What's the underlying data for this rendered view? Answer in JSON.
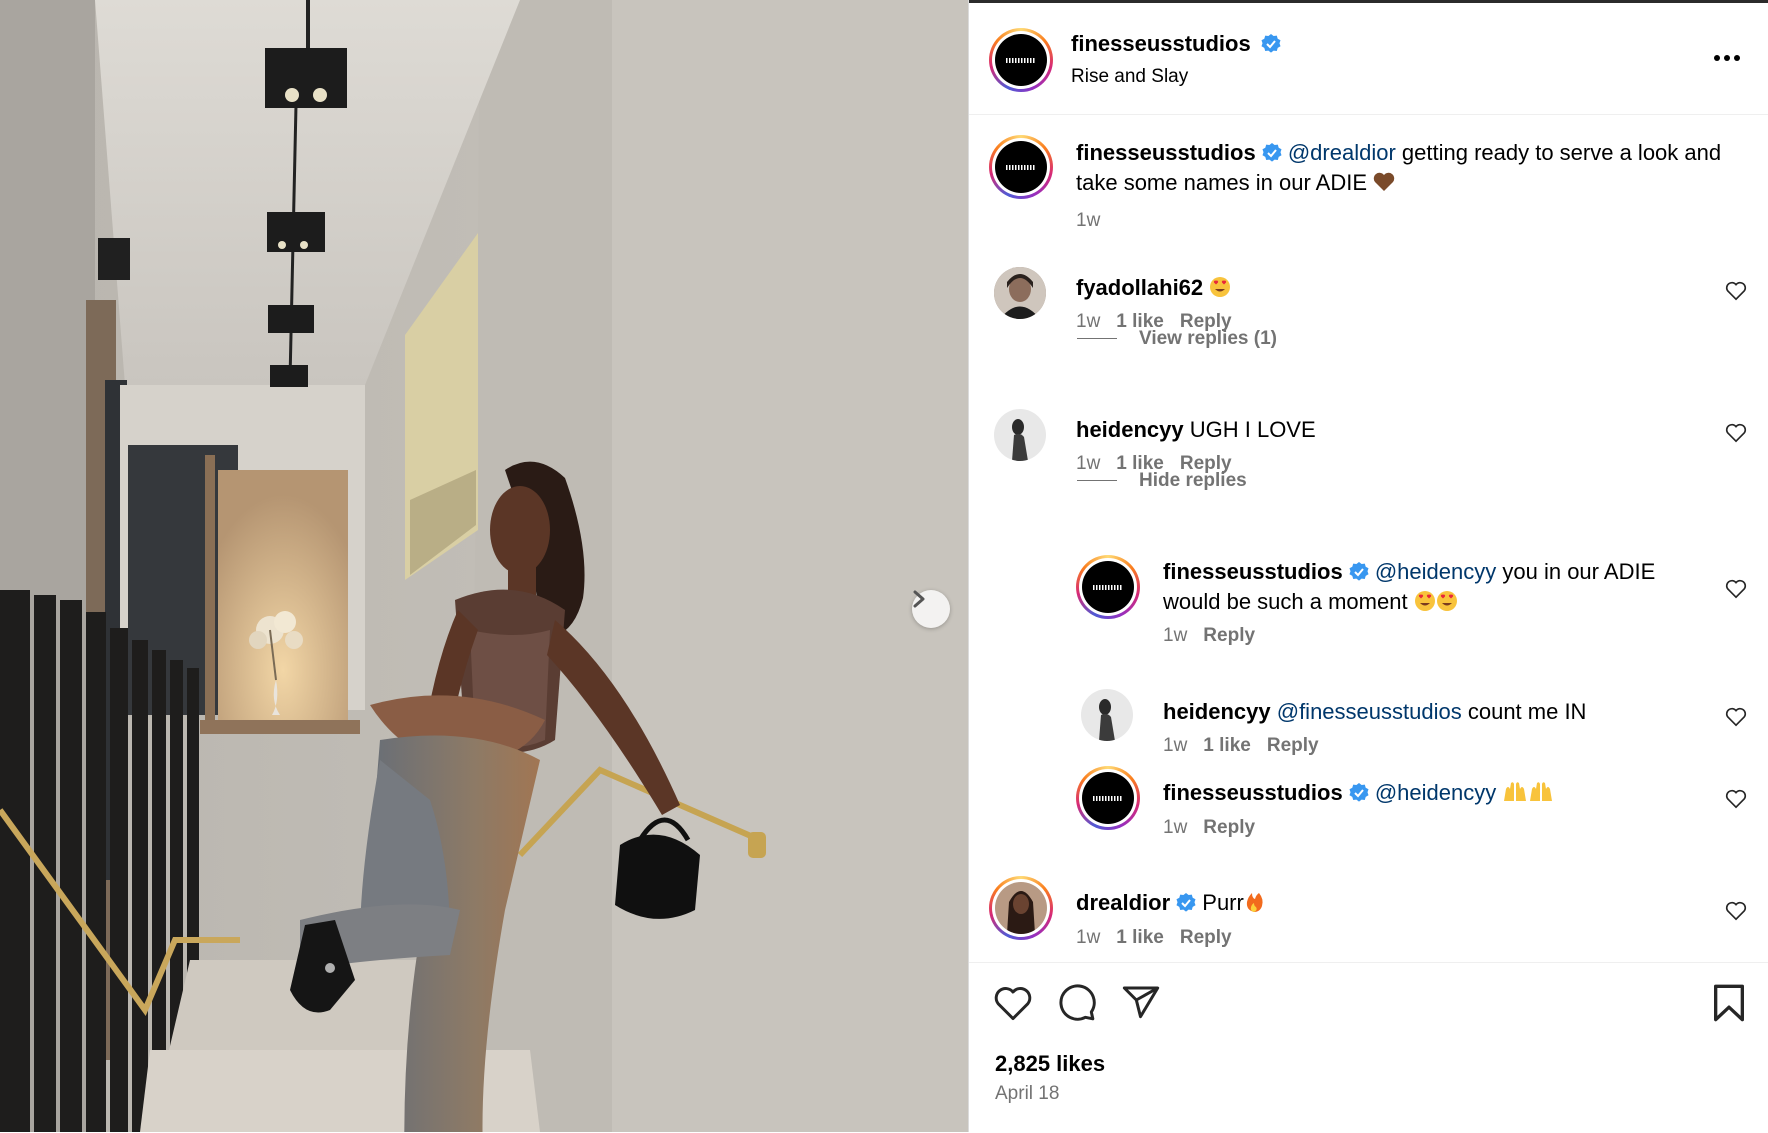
{
  "post": {
    "author": "finesseusstudios",
    "subtitle": "Rise and Slay",
    "caption_mention": "@drealdior",
    "caption_text": "getting ready to serve a look and take some names in our ADIE",
    "caption_time": "1w"
  },
  "comments": [
    {
      "user": "fyadollahi62",
      "text": "",
      "time": "1w",
      "likes": "1 like",
      "reply": "Reply",
      "toggle": "View replies (1)"
    },
    {
      "user": "heidencyy",
      "text": "UGH I LOVE",
      "time": "1w",
      "likes": "1 like",
      "reply": "Reply",
      "toggle": "Hide replies"
    },
    {
      "user": "finesseusstudios",
      "mention": "@heidencyy",
      "text": "you in our ADIE would be such a moment",
      "time": "1w",
      "reply": "Reply"
    },
    {
      "user": "heidencyy",
      "mention": "@finesseusstudios",
      "text": "count me IN",
      "time": "1w",
      "likes": "1 like",
      "reply": "Reply"
    },
    {
      "user": "finesseusstudios",
      "mention": "@heidencyy",
      "text": "",
      "time": "1w",
      "reply": "Reply"
    },
    {
      "user": "drealdior",
      "text": "Purr",
      "time": "1w",
      "likes": "1 like",
      "reply": "Reply"
    }
  ],
  "footer": {
    "likes": "2,825 likes",
    "date": "April 18"
  },
  "icons": {
    "verified_color": "#3897f0",
    "more": "more-options-icon",
    "like": "heart-icon",
    "comment": "comment-bubble-icon",
    "share": "paper-plane-icon",
    "save": "bookmark-icon",
    "next": "chevron-right-icon"
  }
}
